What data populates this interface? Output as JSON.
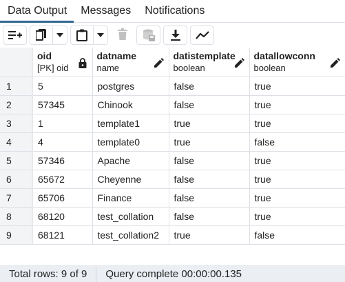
{
  "tabs": [
    "Data Output",
    "Messages",
    "Notifications"
  ],
  "toolbar": {
    "icons": [
      "add-row-icon",
      "copy-icon",
      "chevron-down-icon",
      "paste-icon",
      "chevron-down-icon",
      "delete-icon",
      "save-data-icon",
      "download-icon",
      "graph-icon"
    ]
  },
  "columns": [
    {
      "name": "oid",
      "type": "[PK] oid",
      "icon": "lock-icon"
    },
    {
      "name": "datname",
      "type": "name",
      "icon": "pencil-icon"
    },
    {
      "name": "datistemplate",
      "type": "boolean",
      "icon": "pencil-icon"
    },
    {
      "name": "datallowconn",
      "type": "boolean",
      "icon": "pencil-icon"
    }
  ],
  "rows": [
    {
      "n": "1",
      "cells": [
        "5",
        "postgres",
        "false",
        "true"
      ]
    },
    {
      "n": "2",
      "cells": [
        "57345",
        "Chinook",
        "false",
        "true"
      ]
    },
    {
      "n": "3",
      "cells": [
        "1",
        "template1",
        "true",
        "true"
      ]
    },
    {
      "n": "4",
      "cells": [
        "4",
        "template0",
        "true",
        "false"
      ]
    },
    {
      "n": "5",
      "cells": [
        "57346",
        "Apache",
        "false",
        "true"
      ]
    },
    {
      "n": "6",
      "cells": [
        "65672",
        "Cheyenne",
        "false",
        "true"
      ]
    },
    {
      "n": "7",
      "cells": [
        "65706",
        "Finance",
        "false",
        "true"
      ]
    },
    {
      "n": "8",
      "cells": [
        "68120",
        "test_collation",
        "false",
        "true"
      ]
    },
    {
      "n": "9",
      "cells": [
        "68121",
        "test_collation2",
        "true",
        "false"
      ]
    }
  ],
  "status": {
    "total_rows": "Total rows: 9 of 9",
    "query": "Query complete 00:00:00.135"
  },
  "colors": {
    "accent": "#326690",
    "border": "#dde0e6",
    "status_bg": "#ebeef3"
  }
}
